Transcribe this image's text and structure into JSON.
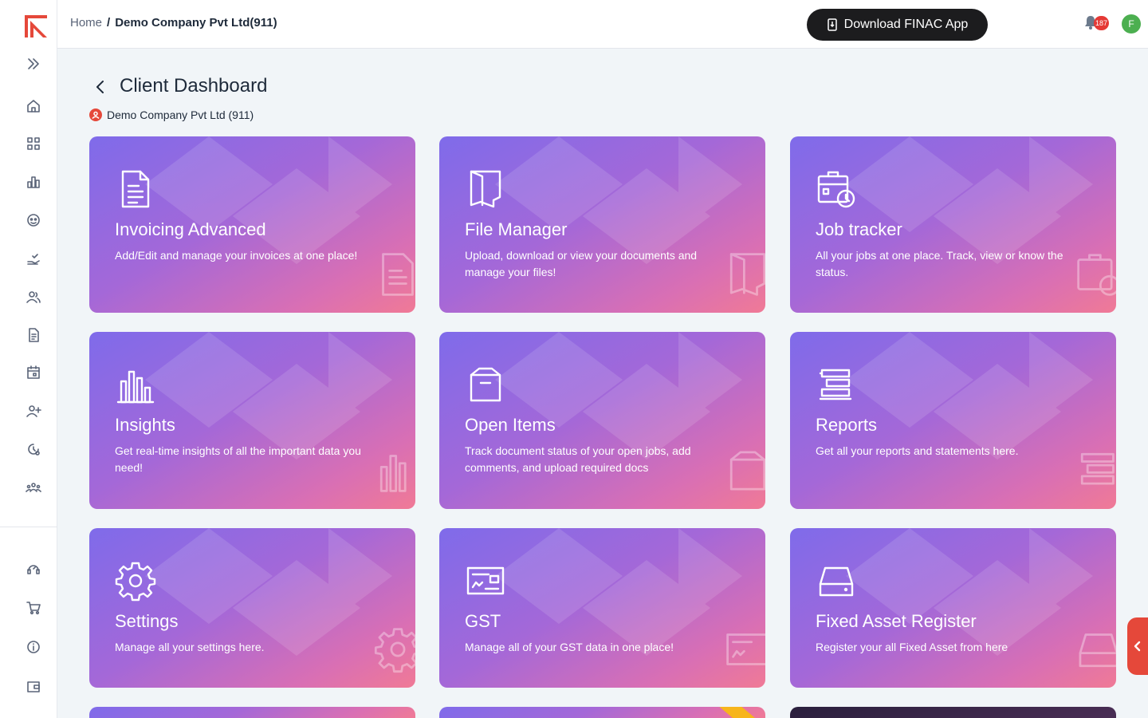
{
  "app": {
    "brand_color": "#e5483a"
  },
  "breadcrumb": {
    "home": "Home",
    "separator": "/",
    "current": "Demo Company Pvt Ltd(911)"
  },
  "header": {
    "download_button": "Download FINAC App",
    "notifications_count": "187",
    "avatar_initial": "F"
  },
  "page": {
    "title": "Client Dashboard",
    "client_name": "Demo Company Pvt Ltd (911)"
  },
  "sidebar": {
    "icons": [
      "home-icon",
      "grid-icon",
      "bar-chart-icon",
      "face-icon",
      "hand-check-icon",
      "users-icon",
      "document-icon",
      "calendar-icon",
      "user-add-icon",
      "gear-history-icon",
      "team-icon",
      "support-icon",
      "cart-icon",
      "info-icon",
      "wallet-icon"
    ]
  },
  "cards": [
    {
      "title": "Invoicing Advanced",
      "description": "Add/Edit and manage your invoices at one place!"
    },
    {
      "title": "File Manager",
      "description": "Upload, download or view your documents and manage your files!"
    },
    {
      "title": "Job tracker",
      "description": "All your jobs at one place. Track, view or know the status."
    },
    {
      "title": "Insights",
      "description": "Get real-time insights of all the important data you need!"
    },
    {
      "title": "Open Items",
      "description": "Track document status of your open jobs, add comments, and upload required docs"
    },
    {
      "title": "Reports",
      "description": "Get all your reports and statements here."
    },
    {
      "title": "Settings",
      "description": "Manage all your settings here."
    },
    {
      "title": "GST",
      "description": "Manage all of your GST data in one place!"
    },
    {
      "title": "Fixed Asset Register",
      "description": "Register your all Fixed Asset from here"
    }
  ]
}
